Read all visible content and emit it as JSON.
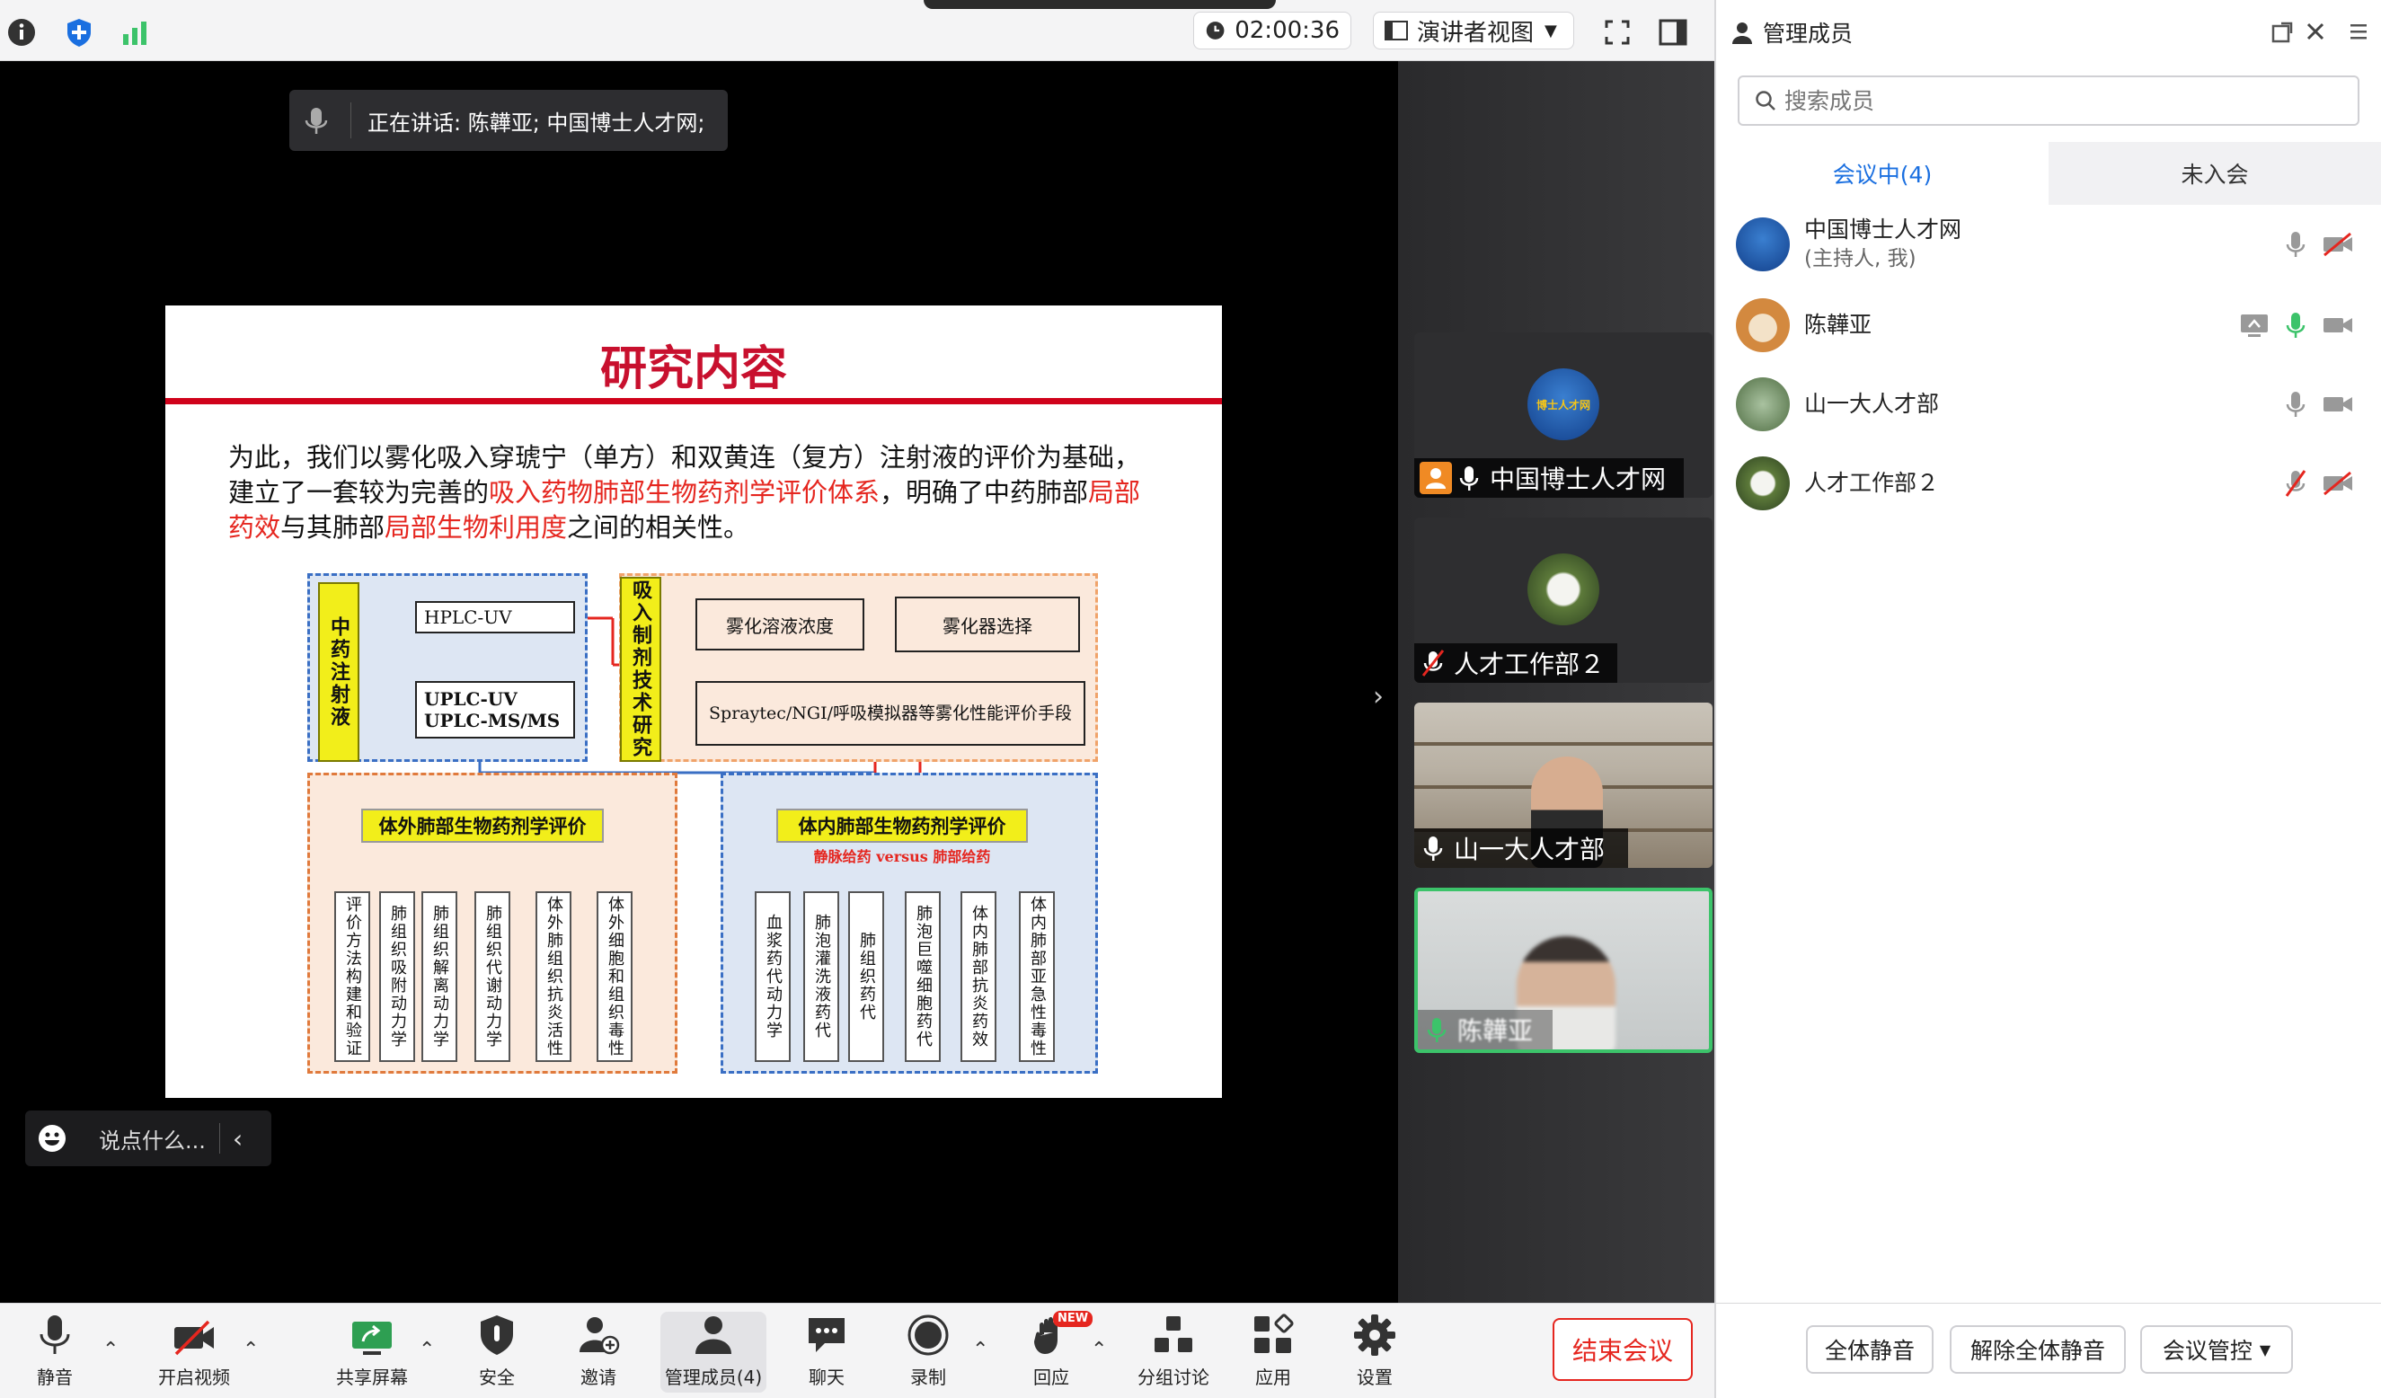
{
  "topbar": {
    "timer": "02:00:36",
    "view_label": "演讲者视图"
  },
  "speaking": {
    "text": "正在讲话: 陈韡亚; 中国博士人才网;"
  },
  "chat": {
    "placeholder": "说点什么..."
  },
  "slide": {
    "title": "研究内容",
    "para": {
      "p1": "为此，我们以雾化吸入穿琥宁（单方）和双黄连（复方）注射液的评价为基础，建立了一套较为完善的",
      "p2": "吸入药物肺部生物药剂学评价体系",
      "p3": "，明确了中药肺部",
      "p4": "局部药效",
      "p5": "与其肺部",
      "p6": "局部生物利用度",
      "p7": "之间的相关性。"
    },
    "diagram": {
      "left_label": "中药注射液",
      "hplc": "HPLC-UV",
      "uplc1": "UPLC-UV",
      "uplc2": "UPLC-MS/MS",
      "inhale_label": "吸入制剂技术研究",
      "conc": "雾化溶液浓度",
      "device": "雾化器选择",
      "spraytec": "Spraytec/NGI/呼吸模拟器等雾化性能评价手段",
      "invitro_title": "体外肺部生物药剂学评价",
      "invivo_title": "体内肺部生物药剂学评价",
      "invivo_sub": "静脉给药 versus 肺部给药",
      "invitro_items": [
        "评价方法构建和验证",
        "肺组织吸附动力学",
        "肺组织解离动力学",
        "肺组织代谢动力学",
        "体外肺组织抗炎活性",
        "体外细胞和组织毒性"
      ],
      "invivo_items": [
        "血浆药代动力学",
        "肺泡灌洗液药代",
        "肺组织药代",
        "肺泡巨噬细胞药代",
        "体内肺部抗炎药效",
        "体内肺部亚急性毒性"
      ]
    }
  },
  "tiles": [
    {
      "name": "中国博士人才网",
      "logo_text": "博士人才网"
    },
    {
      "name": "人才工作部２"
    },
    {
      "name": "山一大人才部"
    },
    {
      "name": "陈韡亚"
    }
  ],
  "panel": {
    "title": "管理成员",
    "search_placeholder": "搜索成员",
    "tab_in": "会议中(4)",
    "tab_out": "未入会",
    "members": [
      {
        "name": "中国博士人才网",
        "sub": "(主持人, 我)"
      },
      {
        "name": "陈韡亚",
        "sub": ""
      },
      {
        "name": "山一大人才部",
        "sub": ""
      },
      {
        "name": "人才工作部２",
        "sub": ""
      }
    ],
    "mute_all": "全体静音",
    "unmute_all": "解除全体静音",
    "control": "会议管控"
  },
  "toolbar": {
    "mute": "静音",
    "video": "开启视频",
    "share": "共享屏幕",
    "security": "安全",
    "invite": "邀请",
    "members": "管理成员(4)",
    "chat": "聊天",
    "record": "录制",
    "react": "回应",
    "react_badge": "NEW",
    "breakout": "分组讨论",
    "apps": "应用",
    "settings": "设置",
    "end": "结束会议"
  },
  "colors": {
    "accent": "#1a6fe0",
    "red": "#e5261f",
    "green": "#3cc36a",
    "slide_title": "#c8102e"
  }
}
